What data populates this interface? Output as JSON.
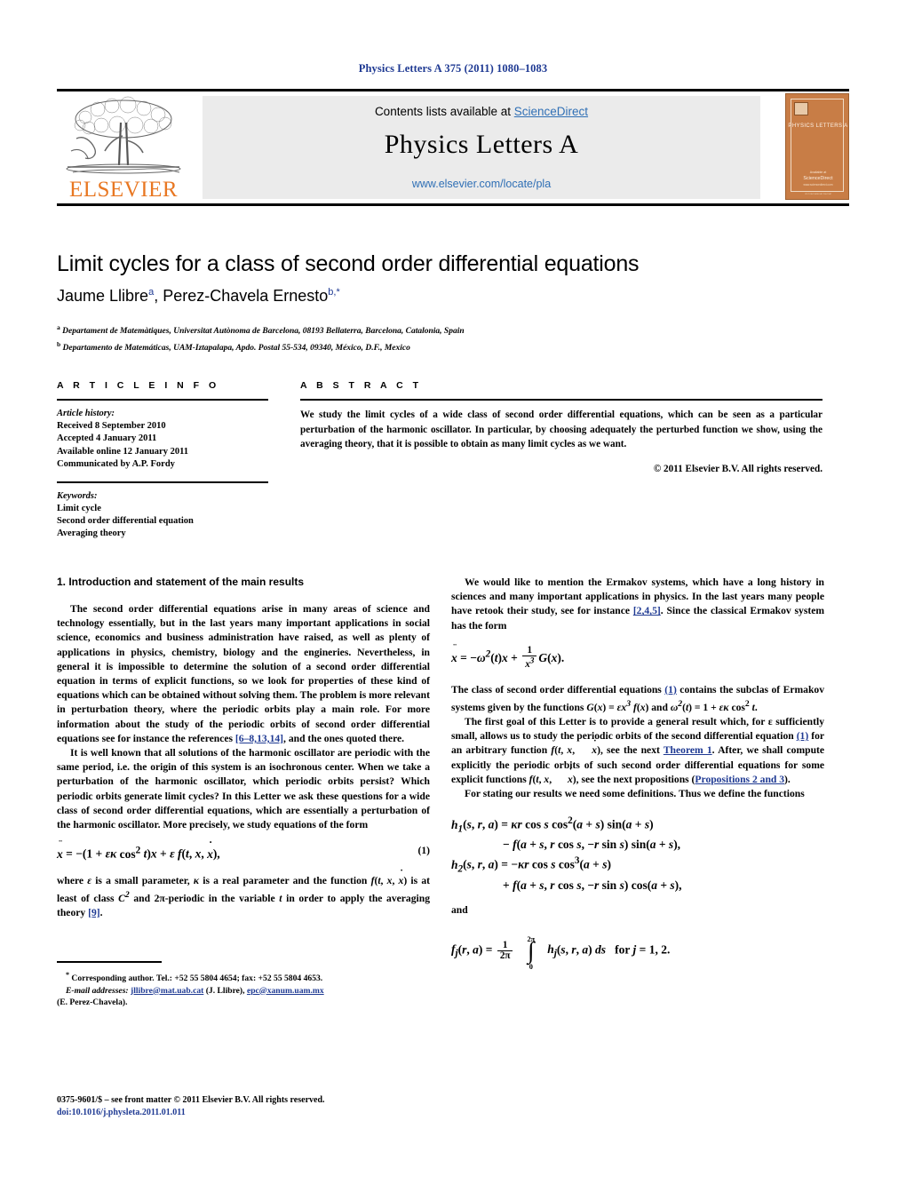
{
  "running_head": "Physics Letters A 375 (2011) 1080–1083",
  "masthead": {
    "contents_prefix": "Contents lists available at ",
    "sciencedirect": "ScienceDirect",
    "journal_title": "Physics Letters A",
    "journal_url": "www.elsevier.com/locate/pla",
    "publisher": "ELSEVIER",
    "cover": {
      "title": "PHYSICS LETTERS A",
      "foot1": "Available at",
      "foot2": "ScienceDirect",
      "foot3": "www.sciencedirect.com",
      "foot4": "An International Journal"
    }
  },
  "article": {
    "title": "Limit cycles for a class of second order differential equations",
    "authors": [
      {
        "name": "Jaume Llibre",
        "marks": "a"
      },
      {
        "name": "Perez-Chavela Ernesto",
        "marks": "b,*"
      }
    ],
    "affiliations": [
      {
        "mark": "a",
        "text": "Departament de Matemàtiques, Universitat Autònoma de Barcelona, 08193 Bellaterra, Barcelona, Catalonia, Spain"
      },
      {
        "mark": "b",
        "text": "Departamento de Matemáticas, UAM-Iztapalapa, Apdo. Postal 55-534, 09340, México, D.F., Mexico"
      }
    ]
  },
  "article_info": {
    "heading": "A R T I C L E   I N F O",
    "history_label": "Article history:",
    "history": [
      "Received 8 September 2010",
      "Accepted 4 January 2011",
      "Available online 12 January 2011",
      "Communicated by A.P. Fordy"
    ],
    "keywords_label": "Keywords:",
    "keywords": [
      "Limit cycle",
      "Second order differential equation",
      "Averaging theory"
    ]
  },
  "abstract": {
    "heading": "A B S T R A C T",
    "text": "We study the limit cycles of a wide class of second order differential equations, which can be seen as a particular perturbation of the harmonic oscillator. In particular, by choosing adequately the perturbed function we show, using the averaging theory, that it is possible to obtain as many limit cycles as we want.",
    "copyright": "© 2011 Elsevier B.V. All rights reserved."
  },
  "body": {
    "section1_heading": "1. Introduction and statement of the main results",
    "left": {
      "p1_a": "The second order differential equations arise in many areas of science and technology essentially, but in the last years many important applications in social science, economics and business administration have raised, as well as plenty of applications in physics, chemistry, biology and the engineries. Nevertheless, in general it is impossible to determine the solution of a second order differential equation in terms of explicit functions, so we look for properties of these kind of equations which can be obtained without solving them. The problem is more relevant in perturbation theory, where the periodic orbits play a main role. For more information about the study of the periodic orbits of second order differential equations see for instance the references ",
      "p1_ref": "[6–8,13,14]",
      "p1_b": ", and the ones quoted there.",
      "p2": "It is well known that all solutions of the harmonic oscillator are periodic with the same period, i.e. the origin of this system is an isochronous center. When we take a perturbation of the harmonic oscillator, which periodic orbits persist? Which periodic orbits generate limit cycles? In this Letter we ask these questions for a wide class of second order differential equations, which are essentially a perturbation of the harmonic oscillator. More precisely, we study equations of the form",
      "eq1_number": "(1)",
      "p3_a": "where ",
      "p3_b": " is a small parameter, ",
      "p3_c": " is a real parameter and the function ",
      "p3_d": " is at least of class ",
      "p3_e": " and 2π-periodic in the variable ",
      "p3_f": " in order to apply the averaging theory ",
      "p3_ref": "[9]",
      "p3_g": "."
    },
    "right": {
      "p1_a": "We would like to mention the Ermakov systems, which have a long history in sciences and many important applications in physics. In the last years many people have retook their study, see for instance ",
      "p1_ref": "[2,4,5]",
      "p1_b": ". Since the classical Ermakov system has the form",
      "p2_a": "The class of second order differential equations ",
      "p2_ref1": "(1)",
      "p2_b": " contains the subclas of Ermakov systems given by the functions ",
      "p2_c": ".",
      "p3_a": "The first goal of this Letter is to provide a general result which, for ε sufficiently small, allows us to study the periodic orbits of the second differential equation ",
      "p3_ref1": "(1)",
      "p3_b": " for an arbitrary function ",
      "p3_c": ", see the next ",
      "p3_ref2": "Theorem 1",
      "p3_d": ". After, we shall compute explicitly the periodic orbits of such second order differential equations for some explicit functions ",
      "p3_e": ", see the next propositions (",
      "p3_ref3": "Propositions 2 and 3",
      "p3_f": ").",
      "p4": "For stating our results we need some definitions. Thus we define the functions",
      "and_word": "and"
    }
  },
  "footnote": {
    "star": "*",
    "corresponding": "Corresponding author. Tel.: +52 55 5804 4654; fax: +52 55 5804 4653.",
    "email_label": "E-mail addresses:",
    "email1": "jllibre@mat.uab.cat",
    "email1_owner": "(J. Llibre)",
    "email2": "epc@xanum.uam.mx",
    "email2_owner": "(E. Perez-Chavela)."
  },
  "imprint": {
    "line1": "0375-9601/$ – see front matter © 2011 Elsevier B.V. All rights reserved.",
    "doi": "doi:10.1016/j.physleta.2011.01.011"
  },
  "colors": {
    "link": "#2f6fb5",
    "ref": "#1f3a93",
    "elsevier_orange": "#E87722",
    "band_gray": "#ebebeb"
  }
}
